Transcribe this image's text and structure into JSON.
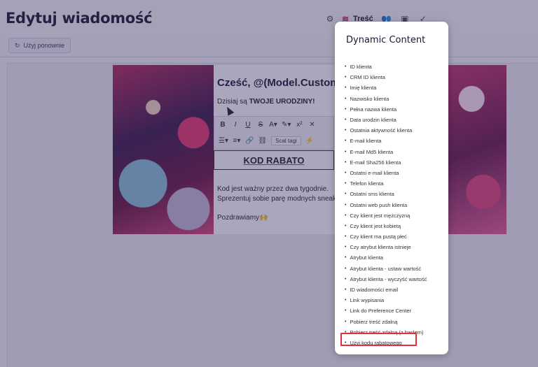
{
  "header": {
    "title": "Edytuj wiadomość",
    "active_tab": "Treść"
  },
  "subbar": {
    "reuse_label": "Użyj ponownie"
  },
  "email": {
    "greeting": "Cześć, @(Model.Custom",
    "today_prefix": "Dzisiaj są ",
    "today_bold": "TWOJE URODZINY!",
    "toolbar": {
      "merge_tags_label": "Scal tagi"
    },
    "coupon": "KOD RABATO",
    "body_line1": "Kod jest ważny przez dwa tygodnie.",
    "body_line2": "Sprezentuj sobie parę modnych sneak",
    "sign_off": "Pozdrawiamy"
  },
  "popup": {
    "title": "Dynamic Content",
    "items": [
      "ID klienta",
      "CRM ID klienta",
      "Imię klienta",
      "Nazwisko klienta",
      "Pełna nazwa klienta",
      "Data urodzin klienta",
      "Ostatnia aktywność klienta",
      "E-mail klienta",
      "E-mail Md5 klienta",
      "E-mail Sha256 klienta",
      "Ostatni e-mail klienta",
      "Telefon klienta",
      "Ostatni sms klienta",
      "Ostatni web push klienta",
      "Czy klient jest mężczyzną",
      "Czy klient jest kobietą",
      "Czy klient ma pustą płeć",
      "Czy atrybut klienta istnieje",
      "Atrybut klienta",
      "Atrybut klienta - ustaw wartość",
      "Atrybut klienta - wyczyść wartość",
      "ID wiadomości email",
      "Link wypisania",
      "Link do Preference Center",
      "Pobierz treść zdalną",
      "Pobierz treść zdalną (z hasłem)",
      "Użyj kodu rabatowego"
    ]
  },
  "colors": {
    "accent": "#b51a5e",
    "highlight": "#e0303a",
    "overlay": "#342e60"
  }
}
